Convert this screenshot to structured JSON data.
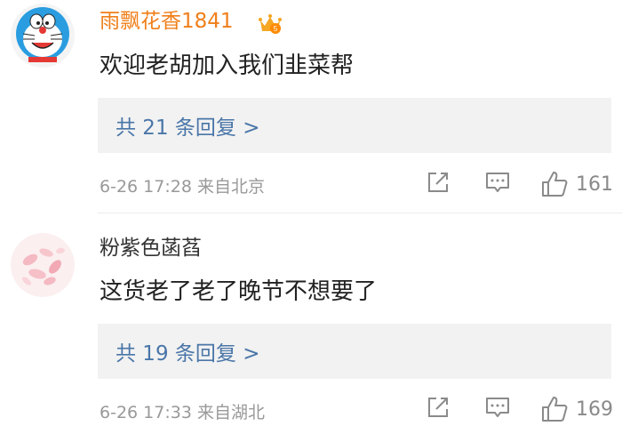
{
  "comments": [
    {
      "username": "雨飘花香1841",
      "text": "欢迎老胡加入我们韭菜帮",
      "replies_label": "共 21 条回复 >",
      "timestamp": "6-26 17:28",
      "location": "来自北京",
      "like_count": "161",
      "avatar": "doraemon-avatar",
      "badge": "vip-crown-badge"
    },
    {
      "username": "粉紫色菡萏",
      "text": "这货老了老了晚节不想要了",
      "replies_label": "共 19 条回复 >",
      "timestamp": "6-26 17:33",
      "location": "来自湖北",
      "like_count": "169",
      "avatar": "petals-avatar"
    }
  ],
  "colors": {
    "vip_username": "#f07f1a",
    "username": "#333333",
    "reply_link": "#4a76a8",
    "meta": "#999999",
    "reply_box_bg": "#f2f2f2"
  },
  "icons": [
    "share-icon",
    "comment-icon",
    "like-icon"
  ]
}
